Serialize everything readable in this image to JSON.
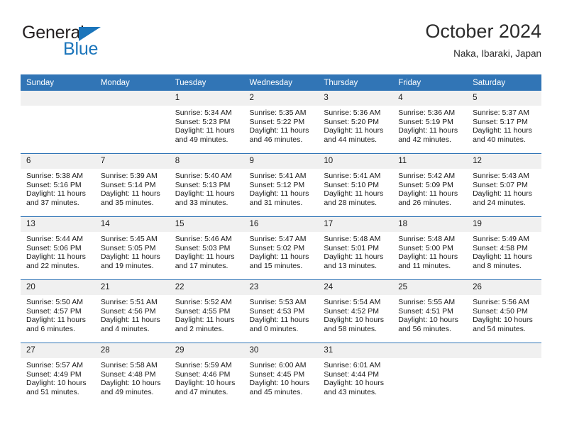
{
  "brand": {
    "name_top": "General",
    "name_bottom": "Blue",
    "accent_color": "#1b75bb",
    "triangle_icon": "triangle-right-icon"
  },
  "header": {
    "title": "October 2024",
    "subtitle": "Naka, Ibaraki, Japan"
  },
  "calendar": {
    "header_bg": "#3175b6",
    "daynum_bg": "#f0f0f0",
    "weekdays": [
      "Sunday",
      "Monday",
      "Tuesday",
      "Wednesday",
      "Thursday",
      "Friday",
      "Saturday"
    ],
    "weeks": [
      [
        {
          "day": "",
          "lines": []
        },
        {
          "day": "",
          "lines": []
        },
        {
          "day": "1",
          "lines": [
            "Sunrise: 5:34 AM",
            "Sunset: 5:23 PM",
            "Daylight: 11 hours",
            "and 49 minutes."
          ]
        },
        {
          "day": "2",
          "lines": [
            "Sunrise: 5:35 AM",
            "Sunset: 5:22 PM",
            "Daylight: 11 hours",
            "and 46 minutes."
          ]
        },
        {
          "day": "3",
          "lines": [
            "Sunrise: 5:36 AM",
            "Sunset: 5:20 PM",
            "Daylight: 11 hours",
            "and 44 minutes."
          ]
        },
        {
          "day": "4",
          "lines": [
            "Sunrise: 5:36 AM",
            "Sunset: 5:19 PM",
            "Daylight: 11 hours",
            "and 42 minutes."
          ]
        },
        {
          "day": "5",
          "lines": [
            "Sunrise: 5:37 AM",
            "Sunset: 5:17 PM",
            "Daylight: 11 hours",
            "and 40 minutes."
          ]
        }
      ],
      [
        {
          "day": "6",
          "lines": [
            "Sunrise: 5:38 AM",
            "Sunset: 5:16 PM",
            "Daylight: 11 hours",
            "and 37 minutes."
          ]
        },
        {
          "day": "7",
          "lines": [
            "Sunrise: 5:39 AM",
            "Sunset: 5:14 PM",
            "Daylight: 11 hours",
            "and 35 minutes."
          ]
        },
        {
          "day": "8",
          "lines": [
            "Sunrise: 5:40 AM",
            "Sunset: 5:13 PM",
            "Daylight: 11 hours",
            "and 33 minutes."
          ]
        },
        {
          "day": "9",
          "lines": [
            "Sunrise: 5:41 AM",
            "Sunset: 5:12 PM",
            "Daylight: 11 hours",
            "and 31 minutes."
          ]
        },
        {
          "day": "10",
          "lines": [
            "Sunrise: 5:41 AM",
            "Sunset: 5:10 PM",
            "Daylight: 11 hours",
            "and 28 minutes."
          ]
        },
        {
          "day": "11",
          "lines": [
            "Sunrise: 5:42 AM",
            "Sunset: 5:09 PM",
            "Daylight: 11 hours",
            "and 26 minutes."
          ]
        },
        {
          "day": "12",
          "lines": [
            "Sunrise: 5:43 AM",
            "Sunset: 5:07 PM",
            "Daylight: 11 hours",
            "and 24 minutes."
          ]
        }
      ],
      [
        {
          "day": "13",
          "lines": [
            "Sunrise: 5:44 AM",
            "Sunset: 5:06 PM",
            "Daylight: 11 hours",
            "and 22 minutes."
          ]
        },
        {
          "day": "14",
          "lines": [
            "Sunrise: 5:45 AM",
            "Sunset: 5:05 PM",
            "Daylight: 11 hours",
            "and 19 minutes."
          ]
        },
        {
          "day": "15",
          "lines": [
            "Sunrise: 5:46 AM",
            "Sunset: 5:03 PM",
            "Daylight: 11 hours",
            "and 17 minutes."
          ]
        },
        {
          "day": "16",
          "lines": [
            "Sunrise: 5:47 AM",
            "Sunset: 5:02 PM",
            "Daylight: 11 hours",
            "and 15 minutes."
          ]
        },
        {
          "day": "17",
          "lines": [
            "Sunrise: 5:48 AM",
            "Sunset: 5:01 PM",
            "Daylight: 11 hours",
            "and 13 minutes."
          ]
        },
        {
          "day": "18",
          "lines": [
            "Sunrise: 5:48 AM",
            "Sunset: 5:00 PM",
            "Daylight: 11 hours",
            "and 11 minutes."
          ]
        },
        {
          "day": "19",
          "lines": [
            "Sunrise: 5:49 AM",
            "Sunset: 4:58 PM",
            "Daylight: 11 hours",
            "and 8 minutes."
          ]
        }
      ],
      [
        {
          "day": "20",
          "lines": [
            "Sunrise: 5:50 AM",
            "Sunset: 4:57 PM",
            "Daylight: 11 hours",
            "and 6 minutes."
          ]
        },
        {
          "day": "21",
          "lines": [
            "Sunrise: 5:51 AM",
            "Sunset: 4:56 PM",
            "Daylight: 11 hours",
            "and 4 minutes."
          ]
        },
        {
          "day": "22",
          "lines": [
            "Sunrise: 5:52 AM",
            "Sunset: 4:55 PM",
            "Daylight: 11 hours",
            "and 2 minutes."
          ]
        },
        {
          "day": "23",
          "lines": [
            "Sunrise: 5:53 AM",
            "Sunset: 4:53 PM",
            "Daylight: 11 hours",
            "and 0 minutes."
          ]
        },
        {
          "day": "24",
          "lines": [
            "Sunrise: 5:54 AM",
            "Sunset: 4:52 PM",
            "Daylight: 10 hours",
            "and 58 minutes."
          ]
        },
        {
          "day": "25",
          "lines": [
            "Sunrise: 5:55 AM",
            "Sunset: 4:51 PM",
            "Daylight: 10 hours",
            "and 56 minutes."
          ]
        },
        {
          "day": "26",
          "lines": [
            "Sunrise: 5:56 AM",
            "Sunset: 4:50 PM",
            "Daylight: 10 hours",
            "and 54 minutes."
          ]
        }
      ],
      [
        {
          "day": "27",
          "lines": [
            "Sunrise: 5:57 AM",
            "Sunset: 4:49 PM",
            "Daylight: 10 hours",
            "and 51 minutes."
          ]
        },
        {
          "day": "28",
          "lines": [
            "Sunrise: 5:58 AM",
            "Sunset: 4:48 PM",
            "Daylight: 10 hours",
            "and 49 minutes."
          ]
        },
        {
          "day": "29",
          "lines": [
            "Sunrise: 5:59 AM",
            "Sunset: 4:46 PM",
            "Daylight: 10 hours",
            "and 47 minutes."
          ]
        },
        {
          "day": "30",
          "lines": [
            "Sunrise: 6:00 AM",
            "Sunset: 4:45 PM",
            "Daylight: 10 hours",
            "and 45 minutes."
          ]
        },
        {
          "day": "31",
          "lines": [
            "Sunrise: 6:01 AM",
            "Sunset: 4:44 PM",
            "Daylight: 10 hours",
            "and 43 minutes."
          ]
        },
        {
          "day": "",
          "lines": []
        },
        {
          "day": "",
          "lines": []
        }
      ]
    ]
  }
}
